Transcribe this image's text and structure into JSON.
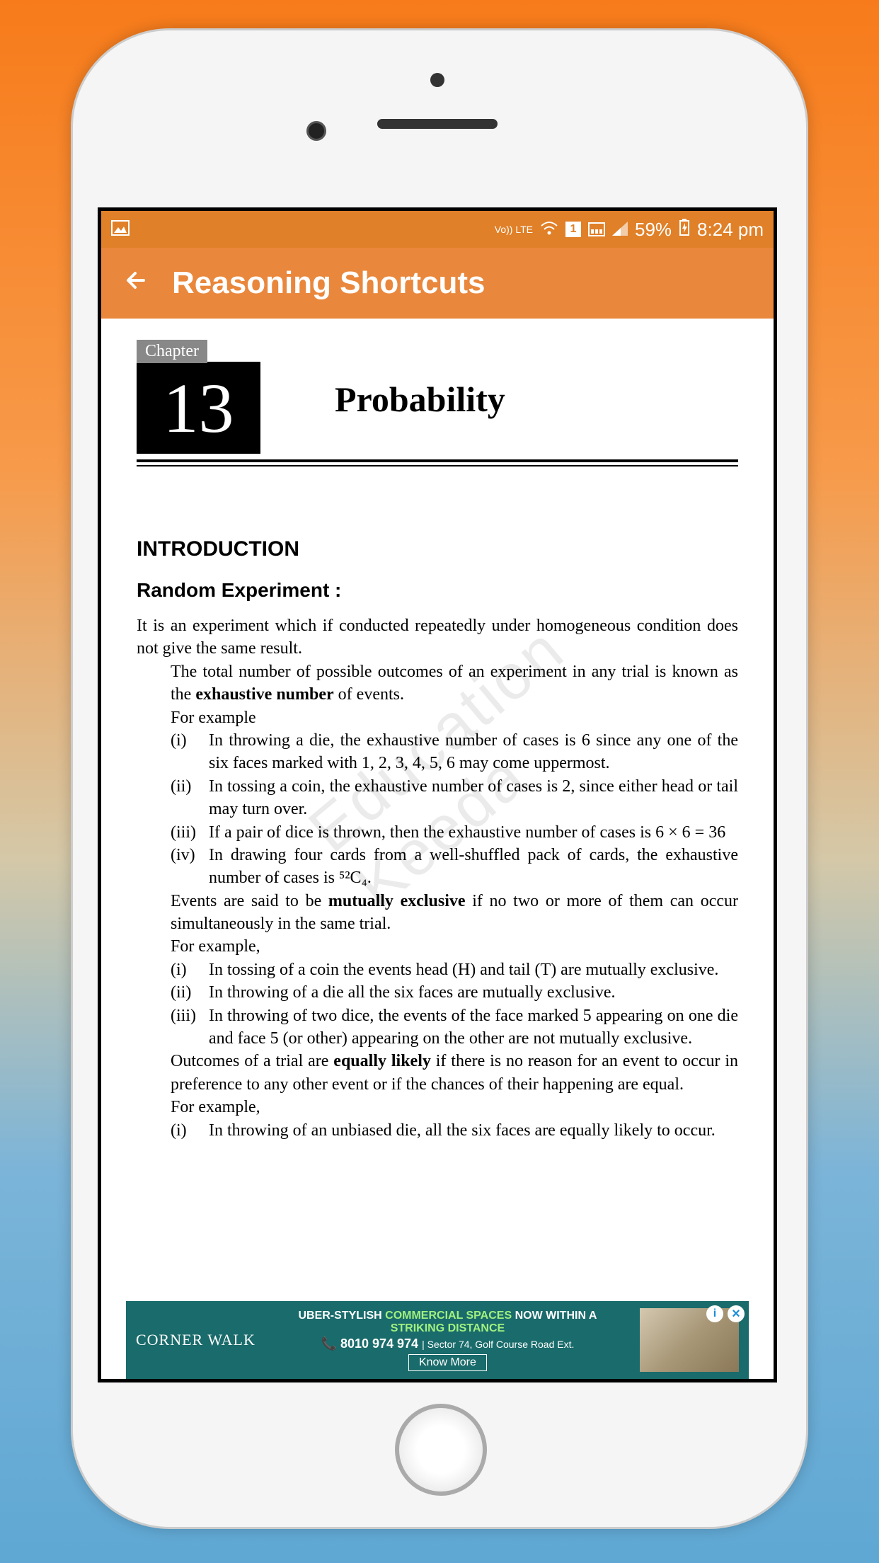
{
  "status": {
    "lte": "Vo)) LTE",
    "sim": "1",
    "battery": "59%",
    "time": "8:24 pm"
  },
  "app": {
    "title": "Reasoning Shortcuts"
  },
  "chapter": {
    "label": "Chapter",
    "number": "13",
    "title": "Probability"
  },
  "section": {
    "intro": "INTRODUCTION",
    "random_exp": "Random Experiment :",
    "para1": "It is an experiment which if conducted repeatedly under homogeneous condition does not give the same result.",
    "para2a": "The total number of possible outcomes of an experiment in any trial is known as the ",
    "para2b": "exhaustive number",
    "para2c": " of events.",
    "for_example": "For example",
    "items1": [
      {
        "m": "(i)",
        "t": "In throwing a die, the exhaustive number of cases is 6 since any one of the six faces marked with 1, 2, 3, 4, 5, 6 may come uppermost."
      },
      {
        "m": "(ii)",
        "t": "In tossing a coin, the exhaustive number of cases is 2, since either head or tail may turn over."
      },
      {
        "m": "(iii)",
        "t": "If a pair of dice is thrown, then the exhaustive number of cases is 6 × 6 = 36"
      },
      {
        "m": "(iv)",
        "t": "In drawing four cards from a well-shuffled pack of cards, the exhaustive number of cases is ⁵²C₄."
      }
    ],
    "para3a": "Events are said to be ",
    "para3b": "mutually exclusive",
    "para3c": " if no two or more of them can occur simultaneously in the same trial.",
    "for_example2": "For example,",
    "items2": [
      {
        "m": "(i)",
        "t": "In tossing of a coin the events head (H) and tail (T) are mutually exclusive."
      },
      {
        "m": "(ii)",
        "t": "In throwing of a die all the six faces are mutually exclusive."
      },
      {
        "m": "(iii)",
        "t": "In throwing of two dice, the events of the face marked 5 appearing on one die and face 5 (or other) appearing on the other are not mutually exclusive."
      }
    ],
    "para4a": "Outcomes of a trial are ",
    "para4b": "equally likely",
    "para4c": " if there is no reason for an event to occur in preference to any other event or if the chances of their happening are equal.",
    "for_example3": "For example,",
    "items3": [
      {
        "m": "(i)",
        "t": "In throwing of an unbiased die, all the six faces are equally likely to occur."
      }
    ]
  },
  "watermark": "Education Keeda",
  "ad": {
    "logo": "CORNER WALK",
    "line1a": "UBER-STYLISH ",
    "line1b": "COMMERCIAL SPACES",
    "line1c": " NOW WITHIN A",
    "line2": "STRIKING DISTANCE",
    "phone": "8010 974 974",
    "sector": "Sector 74, Golf Course Road Ext.",
    "know_more": "Know More"
  }
}
